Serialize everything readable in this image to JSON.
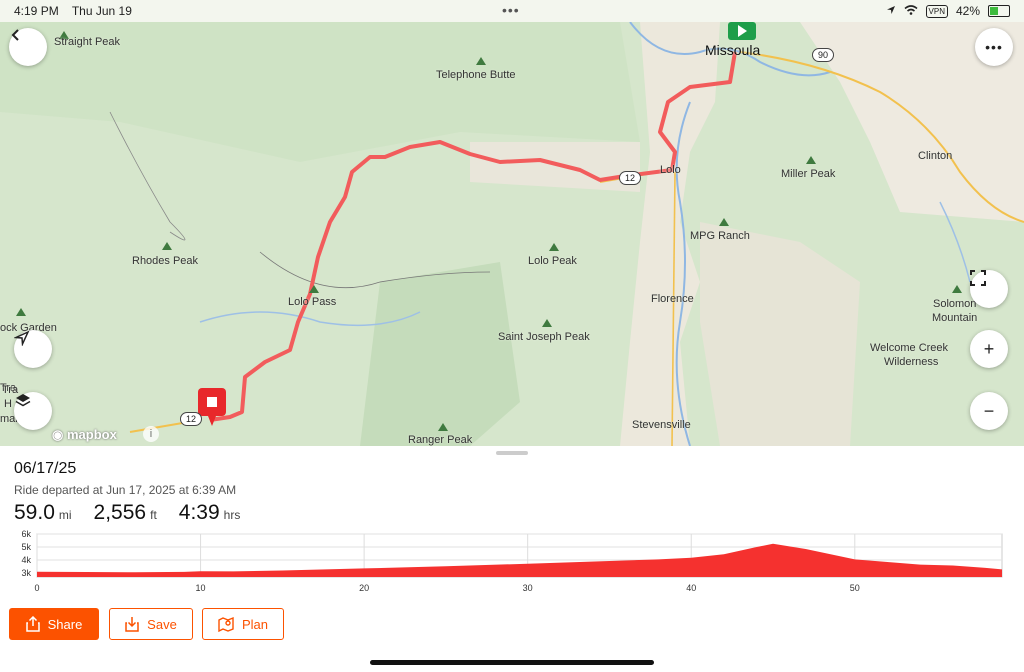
{
  "status_bar": {
    "time": "4:19 PM",
    "date": "Thu Jun 19",
    "vpn": "VPN",
    "battery": "42%",
    "battery_level": 0.42
  },
  "map": {
    "attribution": "mapbox",
    "places": {
      "straight_peak": "Straight Peak",
      "telephone_butte": "Telephone Butte",
      "missoula": "Missoula",
      "clinton": "Clinton",
      "miller_peak": "Miller Peak",
      "lolo": "Lolo",
      "mpg_ranch": "MPG Ranch",
      "rhodes_peak": "Rhodes Peak",
      "lolo_peak": "Lolo Peak",
      "lolo_pass": "Lolo Pass",
      "florence": "Florence",
      "rock_garden": "ock Garden",
      "solomon_mountain_1": "Solomon",
      "solomon_mountain_2": "Mountain",
      "saint_joseph_peak": "Saint Joseph Peak",
      "welcome_creek_1": "Welcome Creek",
      "welcome_creek_2": "Wilderness",
      "tra": "Tra",
      "h": "H",
      "mark": "mark",
      "ranger_peak": "Ranger Peak",
      "stevensville": "Stevensville"
    },
    "shields": {
      "i90": "90",
      "us12_east": "12",
      "us12_west": "12"
    },
    "route_color": "#f25c5c",
    "start_color": "#1e9e4a",
    "end_color": "#e8282b"
  },
  "controls": {
    "back_icon": "chevron-left",
    "more_icon": "ellipsis",
    "fullscreen_icon": "fullscreen-corners",
    "zoom_in_label": "+",
    "zoom_out_label": "−",
    "locate_icon": "navigation-arrow",
    "layers_icon": "layers"
  },
  "activity": {
    "title": "06/17/25",
    "subtitle": "Ride departed at Jun 17, 2025 at 6:39 AM",
    "distance_value": "59.0",
    "distance_unit": "mi",
    "elevation_value": "2,556",
    "elevation_unit": "ft",
    "time_value": "4:39",
    "time_unit": "hrs"
  },
  "chart_data": {
    "type": "area",
    "x_ticks": [
      "0",
      "10",
      "20",
      "30",
      "40",
      "50"
    ],
    "y_ticks": [
      "6k",
      "5k",
      "4k",
      "3k"
    ],
    "xlim": [
      0,
      59
    ],
    "ylim": [
      2700,
      6000
    ],
    "x": [
      0,
      3,
      6,
      9,
      10,
      12,
      15,
      20,
      25,
      30,
      35,
      38,
      40,
      42,
      44,
      45,
      47,
      50,
      52,
      54,
      56,
      58,
      59
    ],
    "y": [
      3100,
      3080,
      3060,
      3090,
      3140,
      3130,
      3200,
      3360,
      3520,
      3720,
      3930,
      4050,
      4180,
      4450,
      5000,
      5250,
      4850,
      4050,
      3850,
      3650,
      3580,
      3400,
      3280
    ],
    "fill_color": "#f5312f"
  },
  "actions": {
    "share_label": "Share",
    "save_label": "Save",
    "plan_label": "Plan",
    "accent": "#fc5200"
  }
}
